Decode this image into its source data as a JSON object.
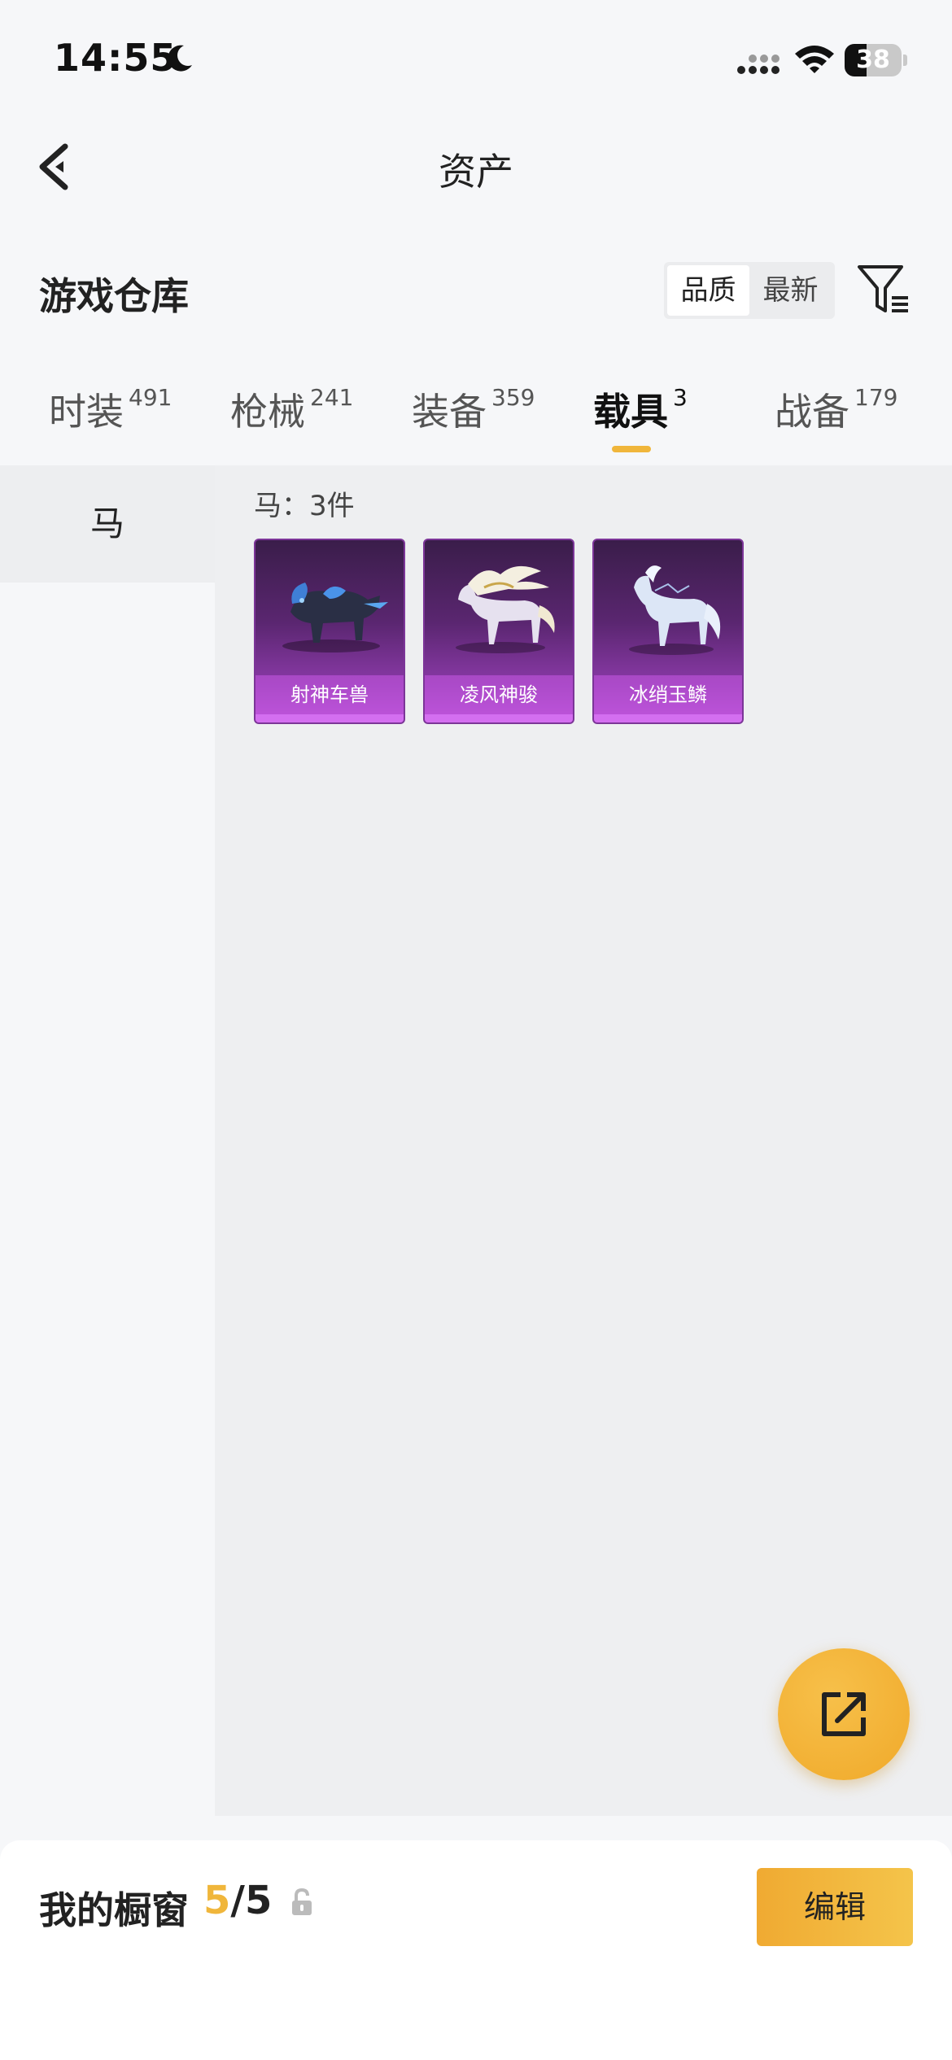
{
  "status_bar": {
    "time": "14:55",
    "battery_level": "38",
    "icons": [
      "moon-icon",
      "signal-icon",
      "wifi-icon",
      "battery-icon"
    ]
  },
  "nav": {
    "title": "资产",
    "back_icon": "chevron-left-icon"
  },
  "warehouse": {
    "title": "游戏仓库",
    "sort_options": [
      "品质",
      "最新"
    ],
    "sort_selected": "品质",
    "filter_icon": "filter-icon"
  },
  "tabs": [
    {
      "label": "时装",
      "count": "491"
    },
    {
      "label": "枪械",
      "count": "241"
    },
    {
      "label": "装备",
      "count": "359"
    },
    {
      "label": "载具",
      "count": "3"
    },
    {
      "label": "战备",
      "count": "179"
    }
  ],
  "active_tab": "载具",
  "colors": {
    "accent": "#f0b63b",
    "item_purple": "#8b3aa8"
  },
  "categories": [
    {
      "label": "马"
    }
  ],
  "items_header": "马：3件",
  "items": [
    {
      "name": "射神车兽"
    },
    {
      "name": "凌风神骏"
    },
    {
      "name": "冰绡玉鳞"
    }
  ],
  "showcase": {
    "label": "我的橱窗",
    "used": "5",
    "total": "/5",
    "edit_label": "编辑"
  }
}
